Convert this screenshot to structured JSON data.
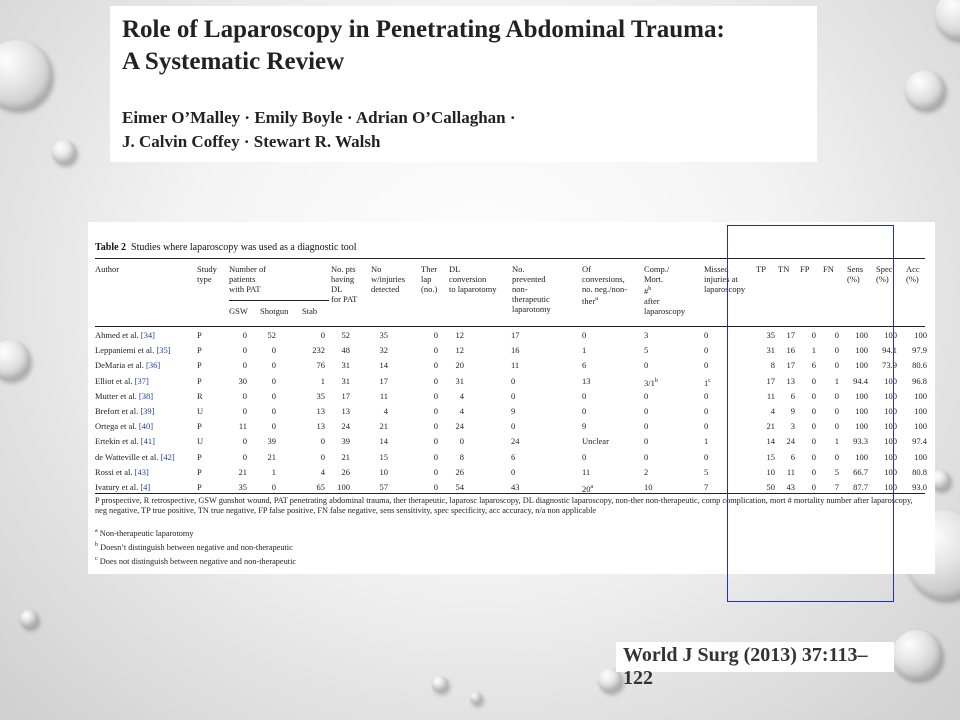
{
  "title": {
    "line1": "Role of Laparoscopy in Penetrating Abdominal Trauma:",
    "line2": "A Systematic Review"
  },
  "authors": {
    "line1": "Eimer O’Malley · Emily Boyle · Adrian O’Callaghan ·",
    "line2": "J. Calvin Coffey · Stewart R. Walsh"
  },
  "table": {
    "caption_label": "Table 2",
    "caption_text": "Studies where laparoscopy was used as a diagnostic tool",
    "headers": {
      "author": "Author",
      "study_type": "Study\ntype",
      "num_patients": "Number of\npatients\nwith PAT",
      "gsw": "GSW",
      "shotgun": "Shotgun",
      "stab": "Stab",
      "dl": "No. pts\nhaving\nDL\nfor PAT",
      "injuries": "No\nw/injuries\ndetected",
      "ther_lap": "Ther\nlap\n(no.)",
      "dl_conv": "DL\nconversion\nto laparotomy",
      "prevented": "No.\nprevented\nnon-\ntherapeutic\nlaparotomy",
      "of_conv": "Of\nconversions,\nno. neg./non-\nther",
      "of_conv_sup": "a",
      "comp": "Comp./\nMort.\n#\nafter\nlaparoscopy",
      "comp_sup": "b",
      "missed": "Missed\ninjuries at\nlaparoscopy",
      "tp": "TP",
      "tn": "TN",
      "fp": "FP",
      "fn": "FN",
      "sens": "Sens\n(%)",
      "spec": "Spec\n(%)",
      "acc": "Acc\n(%)"
    },
    "rows": [
      {
        "author": "Ahmed et al.",
        "ref": "[34]",
        "type": "P",
        "gsw": "0",
        "shotgun": "52",
        "stab": "0",
        "dl": "52",
        "inj": "35",
        "ther": "0",
        "conv": "12",
        "prev": "17",
        "of": "0",
        "of_sup": "",
        "comp": "3",
        "comp_sup": "",
        "missed": "0",
        "missed_sup": "",
        "tp": "35",
        "tn": "17",
        "fp": "0",
        "fn": "0",
        "sens": "100",
        "spec": "100",
        "acc": "100"
      },
      {
        "author": "Leppaniemi et al.",
        "ref": "[35]",
        "type": "P",
        "gsw": "0",
        "shotgun": "0",
        "stab": "232",
        "dl": "48",
        "inj": "32",
        "ther": "0",
        "conv": "12",
        "prev": "16",
        "of": "1",
        "of_sup": "",
        "comp": "5",
        "comp_sup": "",
        "missed": "0",
        "missed_sup": "",
        "tp": "31",
        "tn": "16",
        "fp": "1",
        "fn": "0",
        "sens": "100",
        "spec": "94.1",
        "acc": "97.9"
      },
      {
        "author": "DeMaria et al.",
        "ref": "[36]",
        "type": "P",
        "gsw": "0",
        "shotgun": "0",
        "stab": "76",
        "dl": "31",
        "inj": "14",
        "ther": "0",
        "conv": "20",
        "prev": "11",
        "of": "6",
        "of_sup": "",
        "comp": "0",
        "comp_sup": "",
        "missed": "0",
        "missed_sup": "",
        "tp": "8",
        "tn": "17",
        "fp": "6",
        "fn": "0",
        "sens": "100",
        "spec": "73.9",
        "acc": "80.6"
      },
      {
        "author": "Elliot et al.",
        "ref": "[37]",
        "type": "P",
        "gsw": "30",
        "shotgun": "0",
        "stab": "1",
        "dl": "31",
        "inj": "17",
        "ther": "0",
        "conv": "31",
        "prev": "0",
        "of": "13",
        "of_sup": "",
        "comp": "3/1",
        "comp_sup": "b",
        "missed": "1",
        "missed_sup": "c",
        "tp": "17",
        "tn": "13",
        "fp": "0",
        "fn": "1",
        "sens": "94.4",
        "spec": "100",
        "acc": "96.8"
      },
      {
        "author": "Mutter et al.",
        "ref": "[38]",
        "type": "R",
        "gsw": "0",
        "shotgun": "0",
        "stab": "35",
        "dl": "17",
        "inj": "11",
        "ther": "0",
        "conv": "4",
        "prev": "0",
        "of": "0",
        "of_sup": "",
        "comp": "0",
        "comp_sup": "",
        "missed": "0",
        "missed_sup": "",
        "tp": "11",
        "tn": "6",
        "fp": "0",
        "fn": "0",
        "sens": "100",
        "spec": "100",
        "acc": "100"
      },
      {
        "author": "Brefort et al.",
        "ref": "[39]",
        "type": "U",
        "gsw": "0",
        "shotgun": "0",
        "stab": "13",
        "dl": "13",
        "inj": "4",
        "ther": "0",
        "conv": "4",
        "prev": "9",
        "of": "0",
        "of_sup": "",
        "comp": "0",
        "comp_sup": "",
        "missed": "0",
        "missed_sup": "",
        "tp": "4",
        "tn": "9",
        "fp": "0",
        "fn": "0",
        "sens": "100",
        "spec": "100",
        "acc": "100"
      },
      {
        "author": "Ortega et al.",
        "ref": "[40]",
        "type": "P",
        "gsw": "11",
        "shotgun": "0",
        "stab": "13",
        "dl": "24",
        "inj": "21",
        "ther": "0",
        "conv": "24",
        "prev": "0",
        "of": "9",
        "of_sup": "",
        "comp": "0",
        "comp_sup": "",
        "missed": "0",
        "missed_sup": "",
        "tp": "21",
        "tn": "3",
        "fp": "0",
        "fn": "0",
        "sens": "100",
        "spec": "100",
        "acc": "100"
      },
      {
        "author": "Ertekin et al.",
        "ref": "[41]",
        "type": "U",
        "gsw": "0",
        "shotgun": "39",
        "stab": "0",
        "dl": "39",
        "inj": "14",
        "ther": "0",
        "conv": "0",
        "prev": "24",
        "of": "Unclear",
        "of_sup": "",
        "comp": "0",
        "comp_sup": "",
        "missed": "1",
        "missed_sup": "",
        "tp": "14",
        "tn": "24",
        "fp": "0",
        "fn": "1",
        "sens": "93.3",
        "spec": "100",
        "acc": "97.4"
      },
      {
        "author": "de Watteville et al.",
        "ref": "[42]",
        "type": "P",
        "gsw": "0",
        "shotgun": "21",
        "stab": "0",
        "dl": "21",
        "inj": "15",
        "ther": "0",
        "conv": "8",
        "prev": "6",
        "of": "0",
        "of_sup": "",
        "comp": "0",
        "comp_sup": "",
        "missed": "0",
        "missed_sup": "",
        "tp": "15",
        "tn": "6",
        "fp": "0",
        "fn": "0",
        "sens": "100",
        "spec": "100",
        "acc": "100"
      },
      {
        "author": "Rossi et al.",
        "ref": "[43]",
        "type": "P",
        "gsw": "21",
        "shotgun": "1",
        "stab": "4",
        "dl": "26",
        "inj": "10",
        "ther": "0",
        "conv": "26",
        "prev": "0",
        "of": "11",
        "of_sup": "",
        "comp": "2",
        "comp_sup": "",
        "missed": "5",
        "missed_sup": "",
        "tp": "10",
        "tn": "11",
        "fp": "0",
        "fn": "5",
        "sens": "66.7",
        "spec": "100",
        "acc": "80.8"
      },
      {
        "author": "Ivatury et al.",
        "ref": "[4]",
        "type": "P",
        "gsw": "35",
        "shotgun": "0",
        "stab": "65",
        "dl": "100",
        "inj": "57",
        "ther": "0",
        "conv": "54",
        "prev": "43",
        "of": "20",
        "of_sup": "a",
        "comp": "10",
        "comp_sup": "",
        "missed": "7",
        "missed_sup": "",
        "tp": "50",
        "tn": "43",
        "fp": "0",
        "fn": "7",
        "sens": "87.7",
        "spec": "100",
        "acc": "93.0"
      }
    ],
    "footnote_main": "P prospective, R retrospective, GSW gunshot wound, PAT penetrating abdominal trauma, ther therapeutic, laparosc laparoscopy, DL diagnostic laparoscopy, non-ther non-therapeutic, comp complication, mort # mortality number after laparoscopy, neg negative, TP true positive, TN true negative, FP false positive, FN false negative, sens sensitivity, spec specificity, acc accuracy, n/a non applicable",
    "footnotes": [
      {
        "mark": "a",
        "text": "Non-therapeutic laparotomy"
      },
      {
        "mark": "b",
        "text": "Doesn’t distinguish between negative and non-therapeutic"
      },
      {
        "mark": "c",
        "text": "Does not distinguish between negative and non-therapeutic"
      }
    ]
  },
  "citation": "World J Surg (2013) 37:113–122",
  "colors": {
    "highlight_box": "#2030c8",
    "reference_link": "#1f3fa3"
  }
}
